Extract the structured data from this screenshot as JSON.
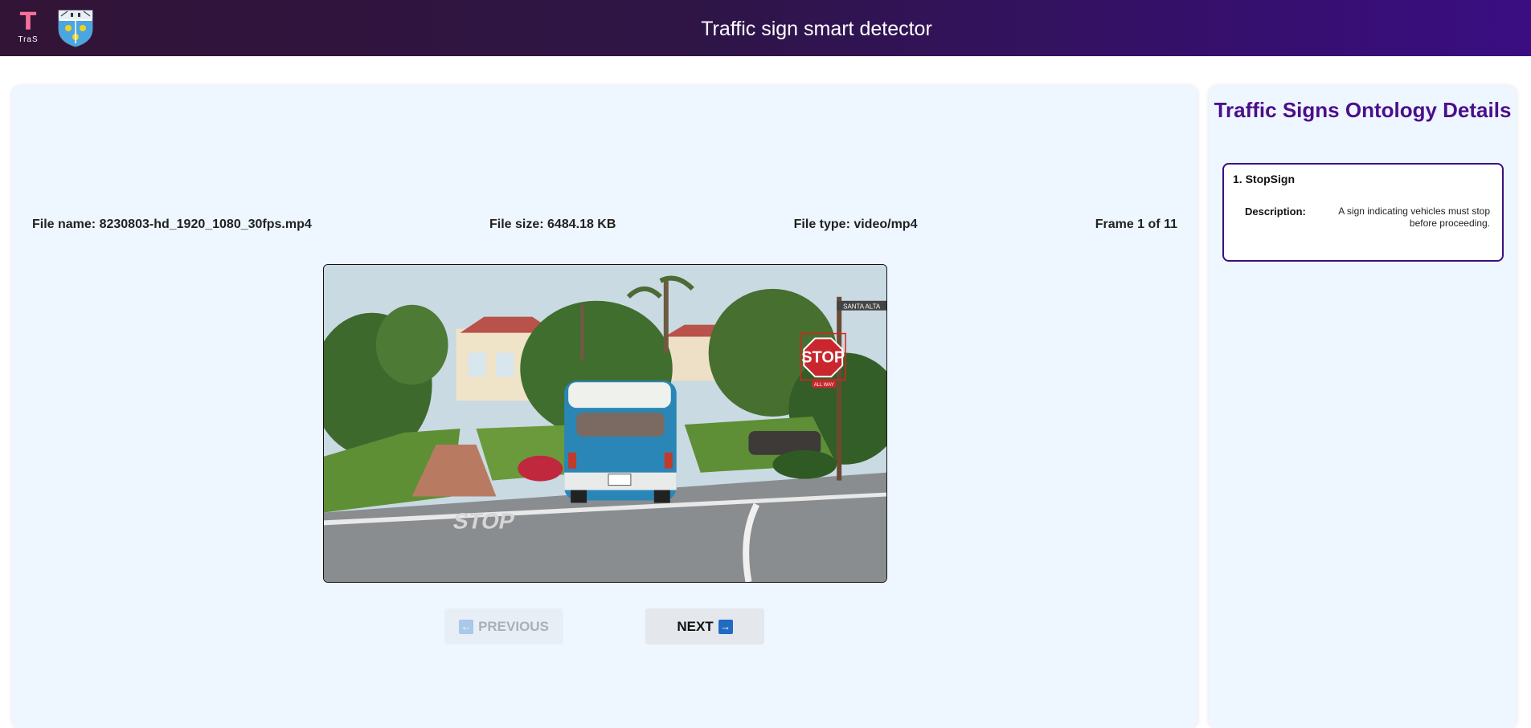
{
  "header": {
    "logo_text": "TraS",
    "logo_letter": "T",
    "title": "Traffic sign smart detector",
    "crest_icon": "university-crest-icon"
  },
  "main": {
    "file_name": "File name: 8230803-hd_1920_1080_30fps.mp4",
    "file_size": "File size: 6484.18 KB",
    "file_type": "File type: video/mp4",
    "frame_counter": "Frame 1 of 11",
    "previous_label": "PREVIOUS",
    "next_label": "NEXT",
    "previous_enabled": false,
    "next_enabled": true,
    "frame_image": {
      "sign_text": "STOP",
      "sub_sign_text": "ALL WAY",
      "street_sign_text": "SANTA ALTA",
      "road_text": "STOP",
      "detection_box_color": "#e02020"
    }
  },
  "ontology": {
    "title": "Traffic Signs Ontology Details",
    "items": [
      {
        "title": "1. StopSign",
        "description_label": "Description:",
        "description": "A sign indicating vehicles must stop before proceeding."
      }
    ]
  },
  "colors": {
    "accent": "#4b0f8a",
    "header_start": "#321436",
    "header_end": "#3a0d82"
  }
}
